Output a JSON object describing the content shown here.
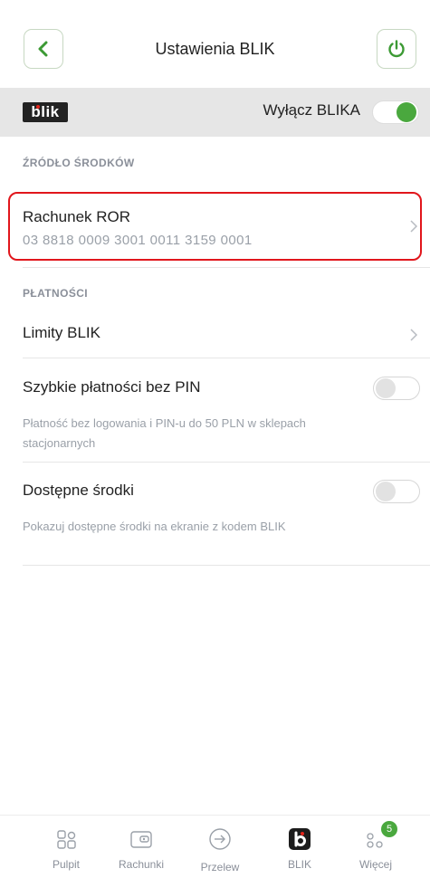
{
  "header": {
    "title": "Ustawienia BLIK"
  },
  "blik_bar": {
    "logo_text": "blik",
    "toggle_label": "Wyłącz BLIKA",
    "toggle_on": true
  },
  "funding": {
    "section_label": "ŹRÓDŁO ŚRODKÓW",
    "account_name": "Rachunek ROR",
    "account_number": "03 8818 0009 3001 0011 3159 0001"
  },
  "payments": {
    "section_label": "PŁATNOŚCI",
    "limits_label": "Limity BLIK",
    "fast_payments": {
      "label": "Szybkie płatności bez PIN",
      "description": "Płatność bez logowania i PIN-u do 50 PLN w sklepach stacjonarnych",
      "enabled": false
    },
    "available_funds": {
      "label": "Dostępne środki",
      "description": "Pokazuj dostępne środki na ekranie z kodem BLIK",
      "enabled": false
    }
  },
  "tabbar": {
    "items": [
      {
        "label": "Pulpit"
      },
      {
        "label": "Rachunki"
      },
      {
        "label": "Przelew"
      },
      {
        "label": "BLIK"
      },
      {
        "label": "Więcej",
        "badge": "5"
      }
    ]
  },
  "colors": {
    "accent": "#4aa83e",
    "highlight": "#e1161c"
  }
}
